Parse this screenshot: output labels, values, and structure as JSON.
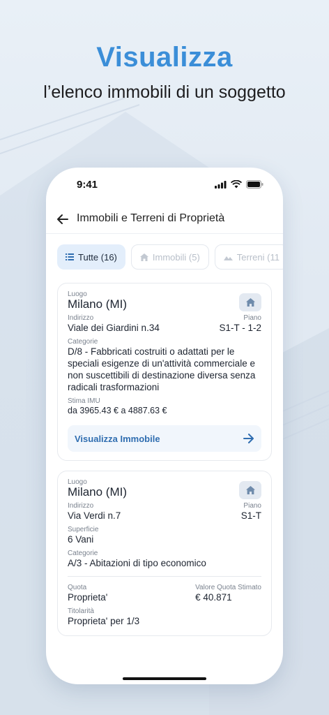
{
  "hero": {
    "title": "Visualizza",
    "subtitle": "l’elenco immobili di un soggetto"
  },
  "status_bar": {
    "time": "9:41"
  },
  "nav": {
    "title": "Immobili e Terreni di Proprietà"
  },
  "tabs": [
    {
      "label": "Tutte (16)",
      "icon": "list-icon",
      "active": true
    },
    {
      "label": "Immobili (5)",
      "icon": "house-icon",
      "active": false
    },
    {
      "label": "Terreni (11",
      "icon": "terrain-icon",
      "active": false
    }
  ],
  "cards": [
    {
      "luogo_label": "Luogo",
      "luogo": "Milano (MI)",
      "indirizzo_label": "Indirizzo",
      "indirizzo": "Viale dei Giardini n.34",
      "piano_label": "Piano",
      "piano": "S1-T - 1-2",
      "categorie_label": "Categorie",
      "categorie": "D/8 - Fabbricati costruiti o adattati per le speciali esigenze di un'attività commerciale e non suscettibili di destinazione diversa senza radicali trasformazioni",
      "stima_label": "Stima IMU",
      "stima": "da 3965.43 €  a 4887.63 €",
      "action_label": "Visualizza Immobile"
    },
    {
      "luogo_label": "Luogo",
      "luogo": "Milano (MI)",
      "indirizzo_label": "Indirizzo",
      "indirizzo": "Via Verdi n.7",
      "piano_label": "Piano",
      "piano": "S1-T",
      "superficie_label": "Superficie",
      "superficie": "6 Vani",
      "categorie_label": "Categorie",
      "categorie": "A/3 - Abitazioni di tipo economico",
      "quota_label": "Quota",
      "quota": "Proprieta'",
      "valore_label": "Valore Quota Stimato",
      "valore": "€ 40.871",
      "titolarita_label": "Titolarità",
      "titolarita": "Proprieta' per 1/3"
    }
  ],
  "colors": {
    "accent": "#3b8ed8",
    "link": "#2f6db0",
    "tab_active_bg": "#e3eefb"
  }
}
